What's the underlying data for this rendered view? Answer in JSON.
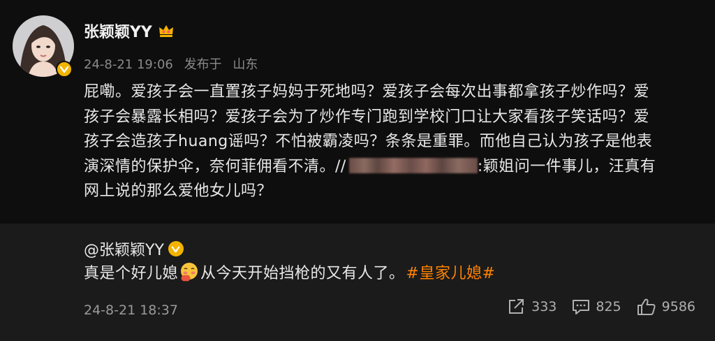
{
  "post": {
    "username": "张颖颖YY",
    "meta": {
      "time": "24-8-21 19:06",
      "location_prefix": "发布于",
      "location": "山东"
    },
    "content": {
      "line1": "屁嘞。爱孩子会一直置孩子妈妈于死地吗？爱孩子会每次出事都拿孩子炒作吗？爱",
      "line2": "孩子会暴露长相吗？爱孩子会为了炒作专门跑到学校门口让大家看孩子笑话吗？爱",
      "line3": "孩子会造孩子huang谣吗？不怕被霸凌吗？条条是重罪。而他自己认为孩子是他表",
      "line4_prefix": "演深情的保护伞，奈何菲佣看不清。//",
      "line4_suffix": ":颖姐问一件事儿，汪真有",
      "line5": "网上说的那么爱他女儿吗？"
    }
  },
  "repost": {
    "mention": "@张颖颖YY",
    "text_before": "真是个好儿媳",
    "text_after": "从今天开始挡枪的又有人了。",
    "hashtag": "#皇家儿媳#"
  },
  "footer": {
    "time": "24-8-21 18:37",
    "share_count": "333",
    "comment_count": "825",
    "like_count": "9586"
  },
  "icons": {
    "crown": "crown-icon",
    "verified": "verified-badge-icon",
    "share": "share-icon",
    "comment": "comment-icon",
    "like": "thumbs-up-icon",
    "emoji": "blushing-face-emoji"
  },
  "colors": {
    "accent": "#ff8200",
    "badge": "#f2b400",
    "background": "#0e0e0e",
    "repost_background": "#1b1b1b"
  }
}
